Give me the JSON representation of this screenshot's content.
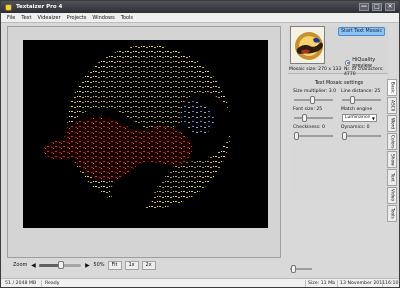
{
  "window": {
    "title": "Textaizer Pro 4",
    "buttons": {
      "minimize": "—",
      "maximize": "□",
      "close": "✕"
    }
  },
  "menu": [
    "File",
    "Text",
    "Videaizer",
    "Projects",
    "Windows",
    "Tools"
  ],
  "preview": {
    "button_label": "Start Text Mosaic",
    "hiquality_label": "HiQuality preview",
    "mosaic_size": "Mosaic size: 270 x 133",
    "characters": "Nr. of characters: 4770"
  },
  "settings": {
    "title": "Text Mosaic settings",
    "size_multiplier": "Size multiplier: 3.0",
    "line_distance": "Line distance: 25",
    "font_size": "Font size: 25",
    "match_engine": "Match engine",
    "match_engine_value": "Luminance",
    "checkiness": "Checkiness: 0",
    "dynamics": "Dynamics: 0"
  },
  "tabs": [
    "Basic",
    "ASCII",
    "Word",
    "Colors",
    "Show",
    "Text",
    "Video",
    "Tools"
  ],
  "zoom": {
    "label": "Zoom",
    "value": "50%",
    "fit": "Fit",
    "x1": "1x",
    "x2": "2x"
  },
  "status": {
    "memory": "51 / 2048 MB",
    "state": "Ready",
    "size": "Size: 11 Mb",
    "date": "13 November 2011",
    "time": "16:10"
  },
  "colors": {
    "accent": "#8dc3f3",
    "background": "#d9d9d9",
    "canvas": "#000000"
  }
}
